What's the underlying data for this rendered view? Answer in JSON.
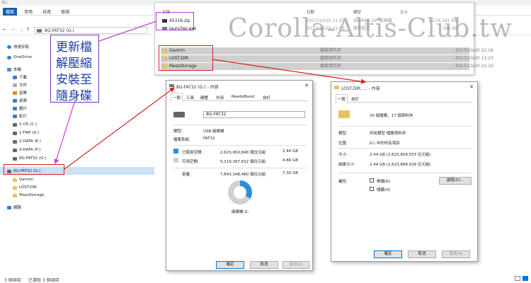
{
  "window": {
    "path_title": "G:\\"
  },
  "ribbon": {
    "tabs": [
      "檔案",
      "常用",
      "共用",
      "檢視"
    ]
  },
  "address": {
    "path": "8G-FAT32 (G:)"
  },
  "nav": {
    "items": [
      {
        "label": "快速存取",
        "color": "#2a7fd4"
      },
      {
        "label": "OneDrive",
        "color": "#2a7fd4"
      },
      {
        "label": "本機",
        "color": "#4a90c8"
      },
      {
        "label": "下載",
        "color": "#3b7bc7"
      },
      {
        "label": "文件",
        "color": "#aaaaaa"
      },
      {
        "label": "音樂",
        "color": "#e08a1e"
      },
      {
        "label": "桌面",
        "color": "#3b7bc7"
      },
      {
        "label": "圖片",
        "color": "#3b7bc7"
      },
      {
        "label": "影片",
        "color": "#3b7bc7"
      },
      {
        "label": "1-OS (C:)",
        "color": "#666666"
      },
      {
        "label": "1-TMP (D:)",
        "color": "#666666"
      },
      {
        "label": "2-DATA (E:)",
        "color": "#666666"
      },
      {
        "label": "3-DATA (F:)",
        "color": "#666666"
      },
      {
        "label": "8G-FAT32 (G:)",
        "color": "#666666"
      },
      {
        "label": "8G-FAT32 (G:)",
        "color": "#666666"
      },
      {
        "label": "Garmin",
        "color": "#e8c35a"
      },
      {
        "label": "LOST.DIR",
        "color": "#e8c35a"
      },
      {
        "label": "MassStorage",
        "color": "#e8c35a"
      },
      {
        "label": "網路",
        "color": "#3b7bc7"
      }
    ]
  },
  "status": {
    "count": "3 個項目",
    "selected": "已選取 3 個項目"
  },
  "listing": {
    "headers": {
      "name": "名稱",
      "date": "日期",
      "type": "類型",
      "size": "大小"
    },
    "files": [
      {
        "name": "45316.zip",
        "date": "2017/10/20 21:47",
        "type": "WinRAR ZIP 壓縮檔",
        "size": "1,114,181 KB"
      },
      {
        "name": "launcher.exe",
        "date": "2017/10/20 21:03",
        "type": "應用程式",
        "size": "396 KB"
      }
    ],
    "folders": [
      {
        "name": "Garmin",
        "type": "檔案資料夾",
        "date": "2017/10/20 22:16"
      },
      {
        "name": "LOST.DIR",
        "type": "檔案資料夾",
        "date": "2017/10/20 13:23"
      },
      {
        "name": "MassStorage",
        "type": "檔案資料夾",
        "date": "2017/10/20 22:16"
      }
    ]
  },
  "drive_dialog": {
    "title": "8G-FAT32 (G:) - 內容",
    "tabs": [
      "一般",
      "工具",
      "硬體",
      "共用",
      "ReadyBoost",
      "自訂"
    ],
    "name": "8G-FAT32",
    "type_label": "類型:",
    "type_value": "USB 磁碟機",
    "fs_label": "檔案系統:",
    "fs_value": "FAT32",
    "used_label": "已使用空間:",
    "used_bytes": "2,623,950,848 個位元組",
    "used_gb": "2.44 GB",
    "free_label": "可用空間:",
    "free_bytes": "5,219,397,632 個位元組",
    "free_gb": "4.86 GB",
    "cap_label": "容量:",
    "cap_bytes": "7,843,348,480 個位元組",
    "cap_gb": "7.30 GB",
    "drive_label": "磁碟機 G:",
    "used_fraction": 0.3345,
    "used_color": "#2b8fd6",
    "free_color": "#d0d0d0",
    "ok": "確定",
    "cancel": "取消",
    "apply": "套用(A)"
  },
  "folder_dialog": {
    "title": "LOST.DIR, ... - 內容",
    "tabs": [
      "一般",
      "自訂"
    ],
    "summary": "30 個檔案，17 個資料夾",
    "type_label": "類型:",
    "type_value": "所有類型 檔案資料夾",
    "loc_label": "位置:",
    "loc_value": "G:\\ 中的所有項目",
    "size_label": "大小:",
    "size_value": "2.44 GB (2,623,809,553 位元組)",
    "disk_label": "磁碟大小:",
    "disk_value": "2.44 GB (2,623,868,928 位元組)",
    "attr_label": "屬性:",
    "readonly": "唯讀(R)",
    "hidden": "隱藏(H)",
    "advanced": "進階(D)...",
    "ok": "確定",
    "cancel": "取消",
    "apply": "套用(A)"
  },
  "annotation": {
    "lines": [
      "更新檔",
      "解壓縮",
      "安裝至",
      "隨身碟"
    ]
  },
  "watermark": "Corolla-Altis-Club.tw"
}
